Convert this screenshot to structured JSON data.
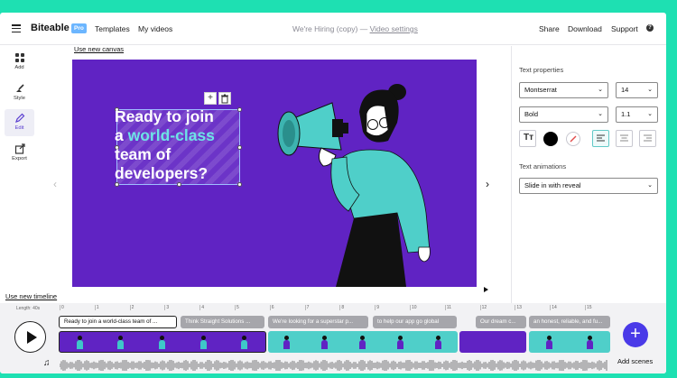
{
  "app": {
    "brand": "Biteable",
    "plan_badge": "Pro",
    "nav": [
      "Templates",
      "My videos"
    ],
    "project_title": "We're Hiring (copy)",
    "title_sep": "—",
    "video_settings_link": "Video settings",
    "actions": {
      "share": "Share",
      "download": "Download",
      "support": "Support",
      "help": "?"
    }
  },
  "sidebar": {
    "items": [
      {
        "label": "Add",
        "icon": "grid-icon"
      },
      {
        "label": "Style",
        "icon": "paint-icon"
      },
      {
        "label": "Edit",
        "icon": "pencil-icon"
      },
      {
        "label": "Export",
        "icon": "export-icon"
      }
    ],
    "active": "Edit"
  },
  "canvas": {
    "use_new_canvas_link": "Use new canvas",
    "background_color": "#6023c3",
    "headline": {
      "line1": "Ready to join",
      "line2_prefix": "a ",
      "line2_highlight": "world-class",
      "line3": "team of",
      "line4": "developers?"
    },
    "highlight_color": "#6de3e6"
  },
  "properties": {
    "text_properties_label": "Text properties",
    "font_family": "Montserrat",
    "font_size": "14",
    "font_weight": "Bold",
    "line_height": "1.1",
    "text_color": "#000000",
    "text_animations_label": "Text animations",
    "animation": "Slide in with reveal"
  },
  "timeline": {
    "use_new_timeline_link": "Use new timeline",
    "length_label": "Length: 40s",
    "ruler_ticks": [
      "0",
      "1",
      "2",
      "3",
      "4",
      "5",
      "6",
      "7",
      "8",
      "9",
      "10",
      "11",
      "12",
      "13",
      "14",
      "15"
    ],
    "text_clips": [
      "Ready to join a world-class team of ...",
      "Think Straight Solutions ...",
      "We're looking for a superstar p...",
      "to help our app go global",
      "Our dream c...",
      "an honest, reliable, and fu..."
    ],
    "add_scenes_label": "Add scenes",
    "add_scenes_symbol": "+"
  }
}
